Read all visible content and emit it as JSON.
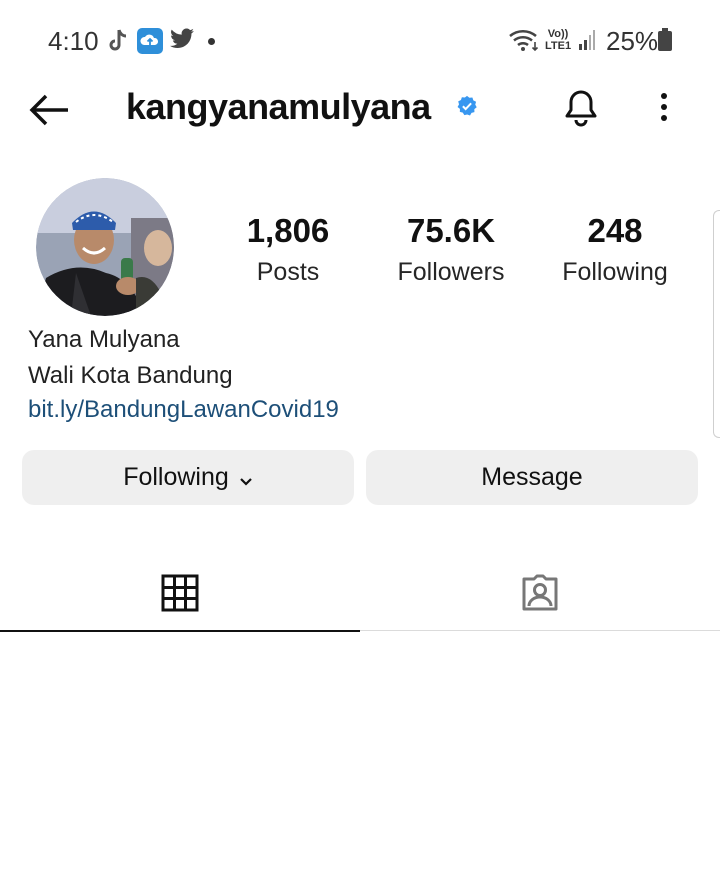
{
  "status_bar": {
    "time": "4:10",
    "volte_top": "Vo))",
    "volte_bottom": "LTE1",
    "battery": "25%"
  },
  "header": {
    "username": "kangyanamulyana"
  },
  "stats": [
    {
      "value": "1,806",
      "label": "Posts"
    },
    {
      "value": "75.6K",
      "label": "Followers"
    },
    {
      "value": "248",
      "label": "Following"
    }
  ],
  "profile": {
    "full_name": "Yana Mulyana",
    "bio": "Wali Kota Bandung",
    "link": "bit.ly/BandungLawanCovid19"
  },
  "buttons": {
    "following": "Following",
    "message": "Message"
  },
  "colors": {
    "verified": "#3897f0",
    "link": "#1d4f78",
    "button_bg": "#efefef"
  },
  "icons": [
    "tiktok-icon",
    "cloud-upload-icon",
    "twitter-icon",
    "wifi-icon",
    "signal-icon",
    "battery-icon",
    "back-arrow-icon",
    "verified-badge-icon",
    "bell-icon",
    "more-vertical-icon",
    "grid-icon",
    "tagged-icon",
    "chevron-down-icon"
  ]
}
